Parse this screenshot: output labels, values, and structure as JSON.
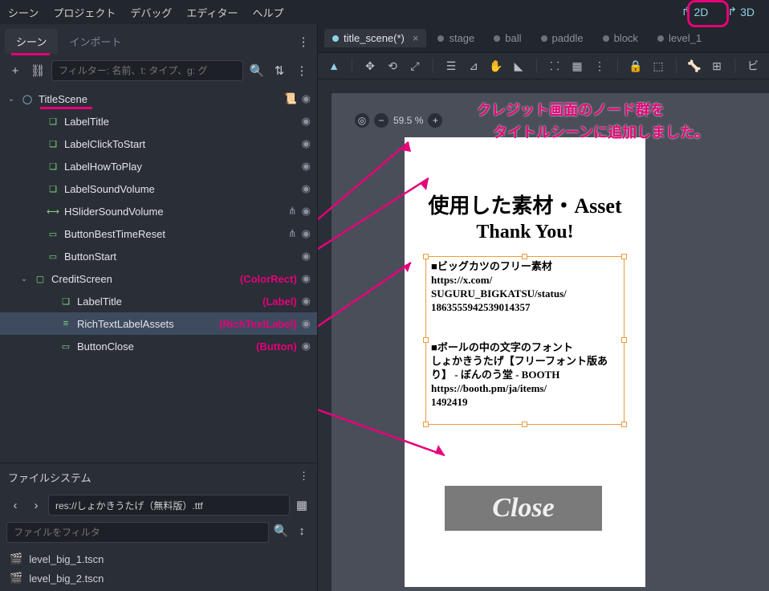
{
  "menu": {
    "scene": "シーン",
    "project": "プロジェクト",
    "debug": "デバッグ",
    "editor": "エディター",
    "help": "ヘルプ"
  },
  "viewmode": {
    "d2": "2D",
    "d3": "3D"
  },
  "dock": {
    "scene_tab": "シーン",
    "import_tab": "インポート",
    "filter_placeholder": "フィルター: 名前、t: タイプ、g: グ"
  },
  "tree": {
    "root": "TitleScene",
    "items": [
      {
        "name": "LabelTitle"
      },
      {
        "name": "LabelClickToStart"
      },
      {
        "name": "LabelHowToPlay"
      },
      {
        "name": "LabelSoundVolume"
      },
      {
        "name": "HSliderSoundVolume"
      },
      {
        "name": "ButtonBestTimeReset"
      },
      {
        "name": "ButtonStart"
      }
    ],
    "credit": {
      "name": "CreditScreen",
      "children": [
        {
          "name": "LabelTitle",
          "ann": "(Label)"
        },
        {
          "name": "RichTextLabelAssets",
          "ann": "(RichTextLabel)"
        },
        {
          "name": "ButtonClose",
          "ann": "(Button)"
        }
      ],
      "ann": "(ColorRect)"
    }
  },
  "filesystem": {
    "title": "ファイルシステム",
    "path": "res://しょかきうたげ（無料版）.ttf",
    "filter_placeholder": "ファイルをフィルタ",
    "items": [
      "level_big_1.tscn",
      "level_big_2.tscn"
    ]
  },
  "tabs": {
    "items": [
      {
        "label": "title_scene(*)",
        "active": true,
        "closable": true
      },
      {
        "label": "stage"
      },
      {
        "label": "ball"
      },
      {
        "label": "paddle"
      },
      {
        "label": "block"
      },
      {
        "label": "level_1"
      }
    ]
  },
  "viewport": {
    "zoom": "59.5 %",
    "callout1": "クレジット画面のノード群を",
    "callout2": "タイトルシーンに追加しました。",
    "credit_title": "使用した素材・Asset",
    "credit_thank": "Thank You!",
    "credit_body": "■ビッグカツのフリー素材\nhttps://x.com/\nSUGURU_BIGKATSU/status/\n1863555942539014357\n\n\n■ボールの中の文字のフォント\nしょかきうたげ【フリーフォント版あり】 - ぼんのう堂 - BOOTH\nhttps://booth.pm/ja/items/\n1492419",
    "close_label": "Close"
  }
}
